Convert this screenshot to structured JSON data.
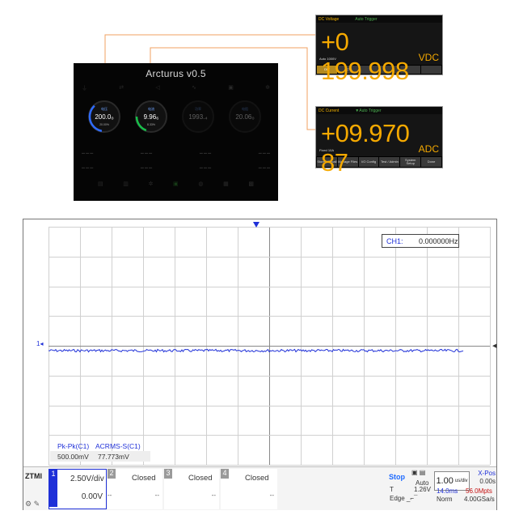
{
  "colors": {
    "accent": "#1f30d8",
    "meter_digits": "#f5a900",
    "stop": "#1f6bff",
    "warn": "#c41010"
  },
  "app": {
    "title": "Arcturus v0.5",
    "gauges": [
      {
        "label": "电压",
        "value": "200.0₀",
        "pct": "20.00%",
        "ring": "#2f6bff"
      },
      {
        "label": "电流",
        "value": "9.96₆",
        "pct": "8.33%",
        "ring": "#18c04a"
      },
      {
        "label": "功率",
        "value": "1993.₄",
        "pct": "",
        "ring": "#2a2a2a"
      },
      {
        "label": "电阻",
        "value": "20.06₀",
        "pct": "",
        "ring": "#2a2a2a"
      }
    ]
  },
  "meters": [
    {
      "header": "DC Voltage",
      "mode": "",
      "trigger": "Auto Trigger",
      "reading": "+0 199.998",
      "unit": "VDC",
      "range": "Auto 1000V",
      "softkeys": [
        "DIV",
        "ACV",
        "",
        "",
        "",
        ""
      ],
      "active": 0
    },
    {
      "header": "DC Current",
      "mode": "",
      "trigger": "▼Auto Trigger",
      "reading": "+09.970 87",
      "unit": "ADC",
      "range": "Fixed 10A",
      "softkeys": [
        "Store / Recall",
        "Manage Files",
        "I/O Config",
        "Test / Admin",
        "System Setup",
        "Done"
      ],
      "active": -1
    }
  ],
  "scope": {
    "ch1_marker": "1",
    "freq": {
      "label": "CH1:",
      "value": "0.000000Hz"
    },
    "measurements": {
      "headers": [
        "Pk-Pk(C1)",
        "ACRMS-S(C1)"
      ],
      "values": [
        "500.00mV",
        "77.773mV"
      ]
    },
    "logo": "ZTMI",
    "channels": [
      {
        "num": "1",
        "scale": "2.50V/div",
        "offset": "0.00V"
      },
      {
        "num": "2",
        "name": "Closed",
        "dash": "--"
      },
      {
        "num": "3",
        "name": "Closed",
        "dash": "--"
      },
      {
        "num": "4",
        "name": "Closed",
        "dash": "--"
      }
    ],
    "status": "Stop",
    "trigger_mode": "Auto",
    "trigger_label": "T",
    "trigger_level": "1.26V",
    "trigger_type": "Edge",
    "timebase": "1.00",
    "timebase_unit": "us/div",
    "xpos_label": "X-Pos",
    "xpos_value": "0.00s",
    "time_span": "14.0ms",
    "memory_depth": "56.0Mpts",
    "acq_mode": "Norm",
    "sample_rate": "4.00GSa/s"
  }
}
